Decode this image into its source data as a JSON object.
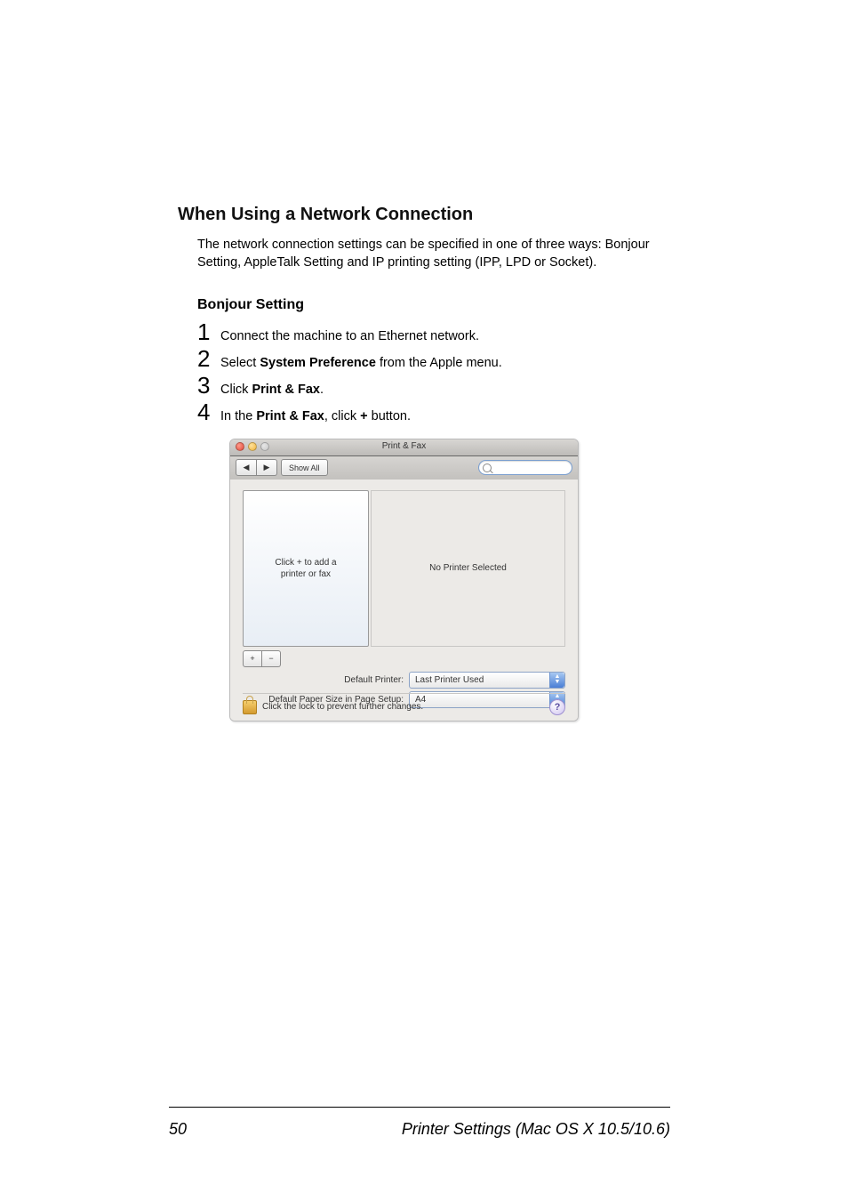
{
  "section_heading": "When Using a Network Connection",
  "intro_text": "The network connection settings can be specified in one of three ways: Bonjour Setting, AppleTalk Setting and IP printing setting (IPP, LPD or Socket).",
  "sub_heading": "Bonjour Setting",
  "steps": {
    "s1": {
      "num": "1",
      "text": "Connect the machine to an Ethernet network."
    },
    "s2": {
      "num": "2",
      "pre": "Select ",
      "bold": "System Preference",
      "post": " from the Apple menu."
    },
    "s3": {
      "num": "3",
      "pre": "Click ",
      "bold": "Print & Fax",
      "post": "."
    },
    "s4": {
      "num": "4",
      "pre": "In the ",
      "bold1": "Print & Fax",
      "mid": ", click ",
      "bold2": "+",
      "post": " button."
    }
  },
  "shot": {
    "title": "Print & Fax",
    "back": "◀",
    "fwd": "▶",
    "show_all": "Show All",
    "search_placeholder": "",
    "list_hint": "Click + to add a\nprinter or fax",
    "detail_hint": "No Printer Selected",
    "plus": "+",
    "minus": "−",
    "row1_label": "Default Printer:",
    "row1_value": "Last Printer Used",
    "row2_label": "Default Paper Size in Page Setup:",
    "row2_value": "A4",
    "lock_text": "Click the lock to prevent further changes.",
    "help": "?"
  },
  "footer": {
    "page": "50",
    "title": "Printer Settings (Mac OS X 10.5/10.6)"
  }
}
